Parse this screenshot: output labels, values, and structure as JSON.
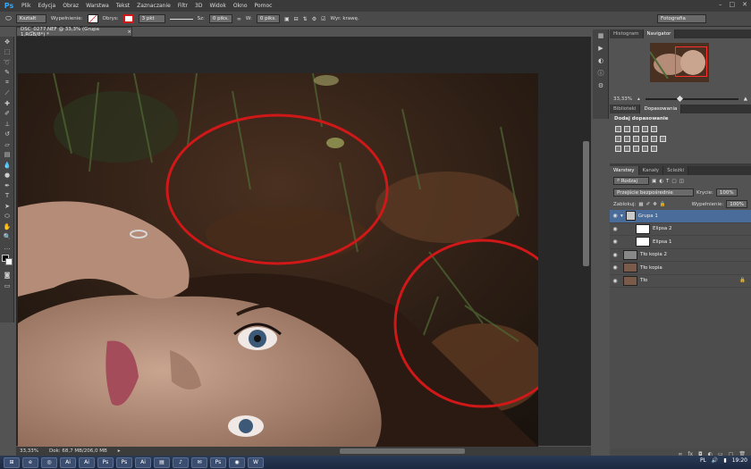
{
  "menubar": {
    "logo": "Ps",
    "items": [
      "Plik",
      "Edycja",
      "Obraz",
      "Warstwa",
      "Tekst",
      "Zaznaczanie",
      "Filtr",
      "3D",
      "Widok",
      "Okno",
      "Pomoc"
    ],
    "window_controls": [
      "–",
      "□",
      "✕"
    ]
  },
  "options": {
    "shape_mode": "Kształt",
    "fill_label": "Wypełnienie:",
    "stroke_label": "Obrys:",
    "stroke_width": "3 pkt",
    "w_label": "Sz:",
    "w_value": "0 piks.",
    "h_label": "W:",
    "h_value": "0 piks.",
    "align_edges": "Wyr. krawę.",
    "workspace": "Fotografia"
  },
  "document": {
    "tab_title": "DSC_0277.NEF @ 33,3% (Grupa 1,RGB/8*) *",
    "zoom": "33,33%",
    "doc_size": "Dok: 68,7 MB/206,0 MB"
  },
  "panels": {
    "nav_tabs": [
      "Histogram",
      "Navigator"
    ],
    "nav_zoom": "33,33%",
    "adj_tabs": [
      "Biblioteki",
      "Dopasowania"
    ],
    "adj_title": "Dodaj dopasowanie",
    "layer_tabs": [
      "Warstwy",
      "Kanały",
      "Ścieżki"
    ],
    "filter_kind": "Rodzaj",
    "blend_mode": "Przejście bezpośrednie",
    "opacity_label": "Krycie:",
    "opacity_value": "100%",
    "lock_label": "Zablokuj:",
    "fill_label": "Wypełnienie:",
    "fill_value": "100%"
  },
  "layers": [
    {
      "name": "Grupa 1",
      "selected": true,
      "indent": 0,
      "type": "group"
    },
    {
      "name": "Elipsa 2",
      "selected": false,
      "indent": 1,
      "type": "shape"
    },
    {
      "name": "Elipsa 1",
      "selected": false,
      "indent": 1,
      "type": "shape"
    },
    {
      "name": "Tło kopia 2",
      "selected": false,
      "indent": 0,
      "type": "blank"
    },
    {
      "name": "Tło kopia",
      "selected": false,
      "indent": 0,
      "type": "photo"
    },
    {
      "name": "Tło",
      "selected": false,
      "indent": 0,
      "type": "photo"
    }
  ],
  "taskbar": {
    "apps": [
      "⊞",
      "e",
      "◎",
      "Ai",
      "Ai",
      "Ps",
      "Ps",
      "Ai",
      "▤",
      "♪",
      "✉",
      "Ps",
      "◉",
      "W"
    ],
    "lang": "PL",
    "time": "19:20"
  },
  "colors": {
    "accent": "#31a8ff",
    "ellipse_stroke": "#d01818",
    "selected_layer": "#4a6c9b"
  }
}
